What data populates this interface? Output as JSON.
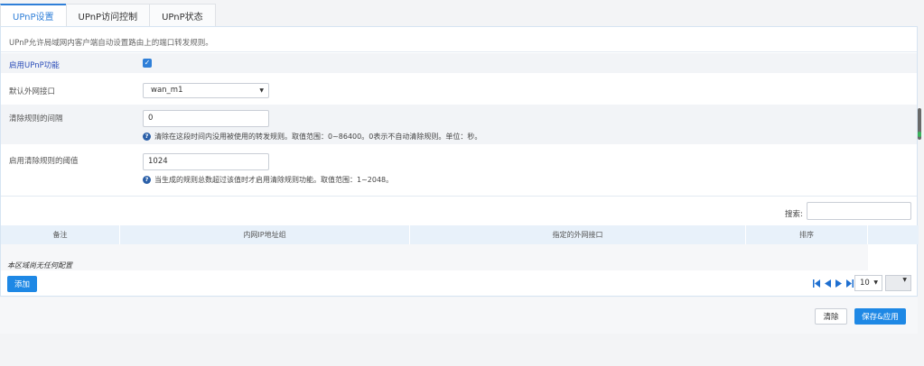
{
  "tabs": [
    {
      "label": "UPnP设置",
      "active": true
    },
    {
      "label": "UPnP访问控制",
      "active": false
    },
    {
      "label": "UPnP状态",
      "active": false
    }
  ],
  "description": "UPnP允许局域网内客户端自动设置路由上的端口转发规则。",
  "form": {
    "enable_label": "启用UPnP功能",
    "enable_checked": true,
    "wan_label": "默认外网接口",
    "wan_value": "wan_m1",
    "interval_label": "清除规则的间隔",
    "interval_value": "0",
    "interval_hint": "清除在这段时间内没用被使用的转发规则。取值范围：0~86400。0表示不自动清除规则。单位：秒。",
    "threshold_label": "启用清除规则的阈值",
    "threshold_value": "1024",
    "threshold_hint": "当生成的规则总数超过该值时才启用清除规则功能。取值范围：1~2048。"
  },
  "table": {
    "search_label": "搜索:",
    "columns": [
      "备注",
      "内网IP地址组",
      "指定的外网接口",
      "排序"
    ],
    "empty_text": "本区域尚无任何配置",
    "add_label": "添加",
    "page_size": "10"
  },
  "footer": {
    "clear_label": "清除",
    "save_label": "保存&应用"
  },
  "colors": {
    "accent": "#1e88e5",
    "tab_active": "#2f7fd8",
    "header_bg": "#e8f1fa"
  }
}
